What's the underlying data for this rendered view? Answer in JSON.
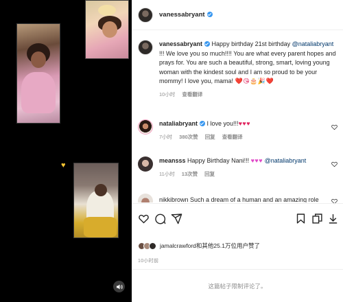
{
  "header": {
    "username": "vanessabryant"
  },
  "caption": {
    "username": "vanessabryant",
    "text_1": " Happy birthday 21st birthday ",
    "mention": "@nataliabryant",
    "text_2": " !!! We love you so much!!!! You are what every parent hopes and prays for. You are such a beautiful, strong, smart, loving young woman with the kindest soul and I am so proud to be your mommy! I love you, mama! ",
    "emojis": "❤️😘🎂🎉❤️",
    "time": "10小时",
    "translate": "查看翻译"
  },
  "comments": [
    {
      "username": "nataliabryant",
      "text": " I love you!!!",
      "emojis": "♥♥♥",
      "time": "7小时",
      "likes": "380次赞",
      "reply": "回复",
      "translate": "查看翻译"
    },
    {
      "username": "meansss",
      "text": " Happy Birthday Nani!!! ",
      "emojis": "♥♥♥",
      "mention": " @nataliabryant",
      "time": "11小时",
      "likes": "13次赞",
      "reply": "回复"
    },
    {
      "username": "nikkibrown",
      "text": "  Such a dream of a human and an amazing role"
    }
  ],
  "likes_summary": {
    "text": "jamalcrawford和其他25.1万位用户赞了"
  },
  "post_time": "10小时前",
  "footer_text": "这篇帖子限制评论了。",
  "icons": [
    "heart-icon",
    "comment-icon",
    "share-icon",
    "save-icon",
    "copy-icon",
    "download-icon",
    "volume-icon"
  ],
  "colors": {
    "accent": "#3897f0",
    "heart": "#e0245e",
    "pink": "#e048c8",
    "mention": "#00376b",
    "muted": "#8e8e8e"
  }
}
